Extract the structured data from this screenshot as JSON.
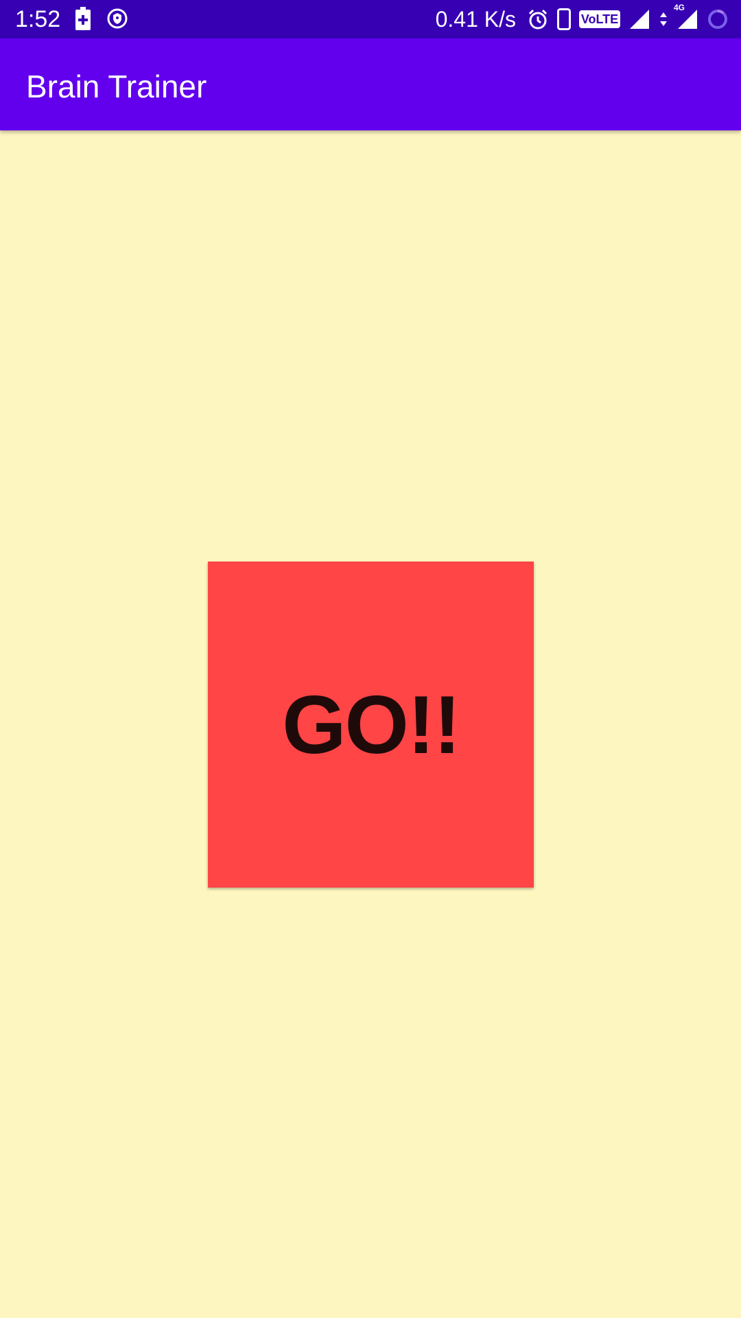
{
  "status_bar": {
    "time": "1:52",
    "net_speed": "0.41 K/s",
    "volte_label": "VoLTE",
    "network_label": "4G",
    "icons": [
      "battery-charging-icon",
      "vpn-shield-icon",
      "alarm-icon",
      "phone-icon",
      "volte-icon",
      "signal-icon",
      "data-arrows-icon",
      "signal-4g-icon",
      "loading-ring-icon"
    ]
  },
  "app_bar": {
    "title": "Brain Trainer"
  },
  "main": {
    "go_button_label": "GO!!"
  },
  "colors": {
    "status_bar": "#3700B3",
    "app_bar": "#6200EE",
    "background": "#FDF6C0",
    "go_button": "#FF4545",
    "go_text": "#1F0A0A"
  }
}
